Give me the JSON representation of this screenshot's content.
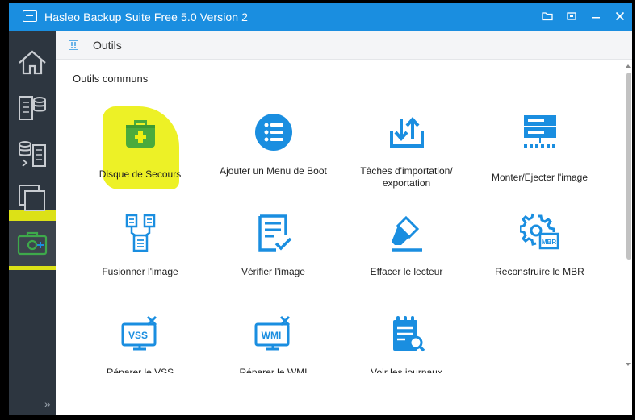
{
  "window": {
    "title": "Hasleo Backup Suite Free 5.0 Version 2",
    "controls": [
      "folder-icon",
      "restore-icon",
      "minimize-icon",
      "close-icon"
    ]
  },
  "sidebar": {
    "items": [
      {
        "name": "home",
        "icon": "home-icon"
      },
      {
        "name": "backup",
        "icon": "backup-icon"
      },
      {
        "name": "restore",
        "icon": "restore-data-icon"
      },
      {
        "name": "clone",
        "icon": "clone-icon"
      },
      {
        "name": "tools",
        "icon": "toolbox-icon",
        "active": true
      }
    ],
    "collapse_label": "»"
  },
  "header": {
    "title": "Outils"
  },
  "section": {
    "title": "Outils communs"
  },
  "tools": [
    {
      "label": "Disque de Secours",
      "icon": "first-aid-case-icon"
    },
    {
      "label": "Ajouter un Menu de Boot",
      "icon": "boot-menu-icon"
    },
    {
      "label": "Tâches d'importation/ exportation",
      "icon": "import-export-icon"
    },
    {
      "label": "Monter/Ejecter l'image",
      "icon": "mount-image-icon"
    },
    {
      "label": "Fusionner l'image",
      "icon": "merge-image-icon"
    },
    {
      "label": "Vérifier l'image",
      "icon": "verify-image-icon"
    },
    {
      "label": "Effacer le lecteur",
      "icon": "eraser-icon"
    },
    {
      "label": "Reconstruire le MBR",
      "icon": "rebuild-mbr-icon",
      "badge": "MBR"
    },
    {
      "label": "Réparer le VSS",
      "icon": "repair-vss-icon",
      "badge": "VSS"
    },
    {
      "label": "Réparer le WMI",
      "icon": "repair-wmi-icon",
      "badge": "WMI"
    },
    {
      "label": "Voir les journaux",
      "icon": "view-logs-icon"
    }
  ],
  "colors": {
    "accent": "#1a8ee0",
    "sidebar": "#2d3640",
    "highlight": "#ebf014",
    "rescue": "#4aab3c"
  }
}
